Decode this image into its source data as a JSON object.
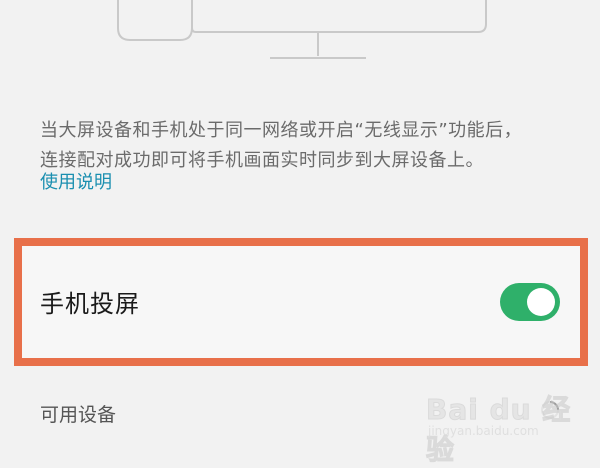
{
  "description": {
    "line1": "当大屏设备和手机处于同一网络或开启“无线显示”功能后，",
    "line2": "连接配对成功即可将手机画面实时同步到大屏设备上。"
  },
  "help_link": "使用说明",
  "screen_mirroring": {
    "label": "手机投屏",
    "enabled": true
  },
  "available_devices": {
    "label": "可用设备"
  },
  "watermark": {
    "logo": "Bai du 经验",
    "url": "jingyan.baidu.com"
  },
  "colors": {
    "accent": "#2fb06a",
    "link": "#1a8fb0",
    "highlight_border": "#e8704a"
  }
}
